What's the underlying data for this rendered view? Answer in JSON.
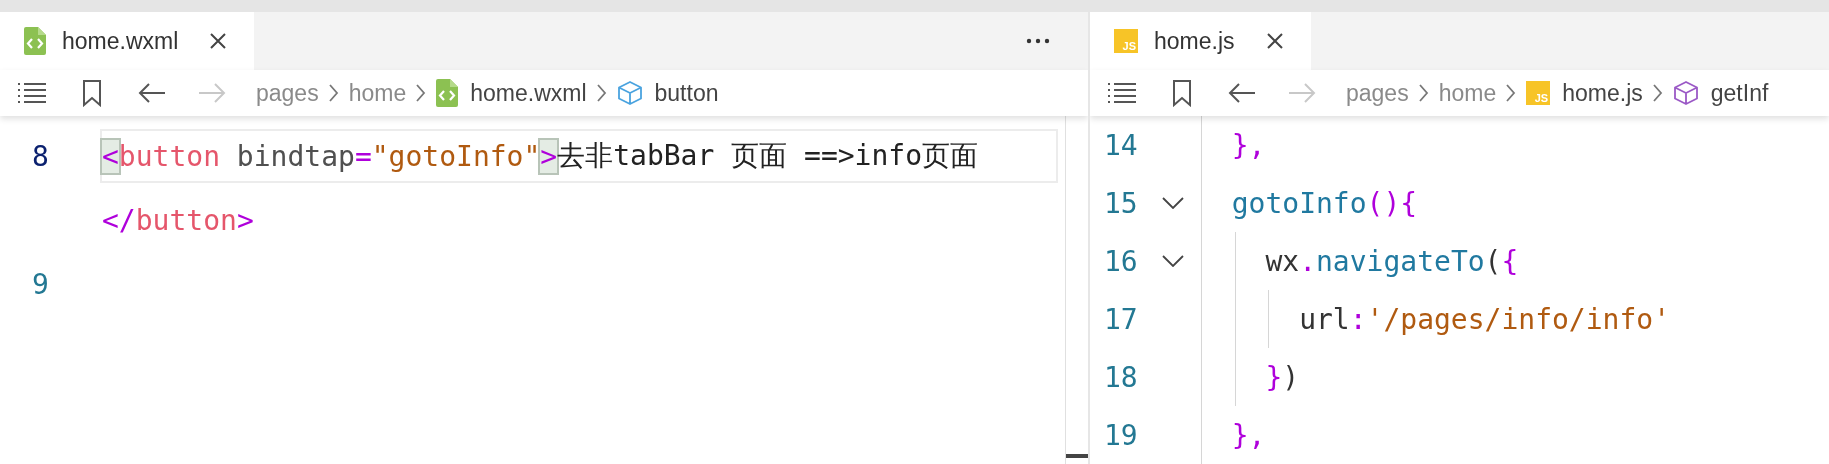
{
  "panes": [
    {
      "tab": {
        "label": "home.wxml",
        "kind": "wxml",
        "selected": true
      },
      "actions_menu": true,
      "nav": {
        "forward_disabled": true
      },
      "breadcrumb": [
        {
          "label": "pages",
          "kind": "folder"
        },
        {
          "label": "home",
          "kind": "folder"
        },
        {
          "label": "home.wxml",
          "kind": "wxml_file"
        },
        {
          "label": "button",
          "kind": "symbol",
          "color": "#4aa3df"
        }
      ],
      "lines": [
        {
          "number": "8",
          "current": true,
          "tokens": [
            {
              "text": "<",
              "kind": "punct",
              "matched": true
            },
            {
              "text": "button",
              "kind": "tag",
              "matched": false
            },
            {
              "text": " bindtap",
              "kind": "attr",
              "matched": false
            },
            {
              "text": "=",
              "kind": "punct",
              "matched": false
            },
            {
              "text": "\"gotoInfo\"",
              "kind": "string",
              "matched": false
            },
            {
              "text": ">",
              "kind": "punct",
              "matched": true
            },
            {
              "text": "去非tabBar 页面 ==>info页面",
              "kind": "text",
              "matched": false
            }
          ]
        },
        {
          "current": false,
          "tokens": [
            {
              "text": "</",
              "kind": "punct"
            },
            {
              "text": "button",
              "kind": "tag"
            },
            {
              "text": ">",
              "kind": "punct"
            }
          ]
        },
        {
          "number": "9",
          "current": false
        }
      ]
    },
    {
      "tab": {
        "label": "home.js",
        "kind": "js",
        "icon_label": "JS",
        "selected": true
      },
      "actions_menu": false,
      "nav": {
        "forward_disabled": true
      },
      "breadcrumb": [
        {
          "label": "pages",
          "kind": "folder"
        },
        {
          "label": "home",
          "kind": "folder"
        },
        {
          "label": "home.js",
          "kind": "js_file",
          "icon_label": "JS"
        },
        {
          "label": "getInf",
          "kind": "symbol",
          "color": "#9b59c6"
        }
      ],
      "lines": [
        {
          "number": "14",
          "foldable": false,
          "tokens": [
            {
              "text": "  },",
              "kind": "punct"
            }
          ]
        },
        {
          "number": "15",
          "foldable": true,
          "tokens": [
            {
              "text": "  gotoInfo",
              "kind": "fn"
            },
            {
              "text": "(){",
              "kind": "punct"
            }
          ]
        },
        {
          "number": "16",
          "foldable": true,
          "tokens": [
            {
              "text": "    wx",
              "kind": "plain"
            },
            {
              "text": ".",
              "kind": "punct"
            },
            {
              "text": "navigateTo",
              "kind": "fn"
            },
            {
              "text": "(",
              "kind": "plain"
            },
            {
              "text": "{",
              "kind": "punct"
            }
          ]
        },
        {
          "number": "17",
          "foldable": false,
          "tokens": [
            {
              "text": "      url",
              "kind": "plain"
            },
            {
              "text": ":",
              "kind": "punct"
            },
            {
              "text": "'/pages/info/info'",
              "kind": "string"
            }
          ]
        },
        {
          "number": "18",
          "foldable": false,
          "tokens": [
            {
              "text": "    }",
              "kind": "punct"
            },
            {
              "text": ")",
              "kind": "plain"
            }
          ]
        },
        {
          "number": "19",
          "foldable": false,
          "tokens": [
            {
              "text": "  },",
              "kind": "punct"
            }
          ]
        }
      ]
    }
  ]
}
